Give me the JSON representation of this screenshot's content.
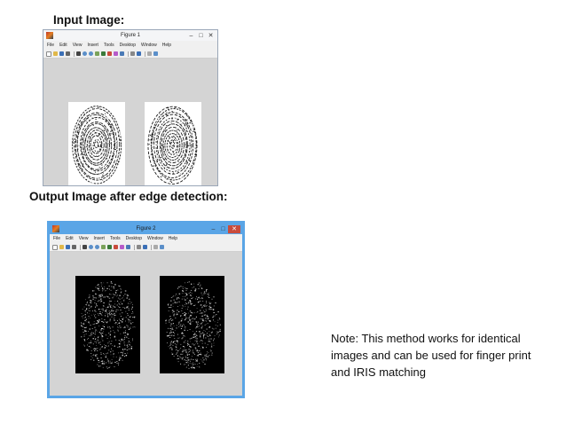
{
  "headings": {
    "input": "Input Image:",
    "output": "Output Image after edge detection:"
  },
  "figure_input": {
    "title": "Figure 1",
    "menu": [
      "File",
      "Edit",
      "View",
      "Insert",
      "Tools",
      "Desktop",
      "Window",
      "Help"
    ],
    "controls": {
      "minimize": "–",
      "maximize": "□",
      "close": "✕"
    }
  },
  "figure_output": {
    "title": "Figure 2",
    "menu": [
      "File",
      "Edit",
      "View",
      "Insert",
      "Tools",
      "Desktop",
      "Window",
      "Help"
    ],
    "controls": {
      "minimize": "–",
      "maximize": "□",
      "close": "✕"
    }
  },
  "note": "Note: This method works for identical images and can be used for finger print and IRIS matching",
  "colors": {
    "figure2_frame": "#5aa5e6",
    "figure_background": "#d4d4d4",
    "edge_pixels": "#ffffff",
    "fingerprint_ridges": "#1a1a1a"
  }
}
